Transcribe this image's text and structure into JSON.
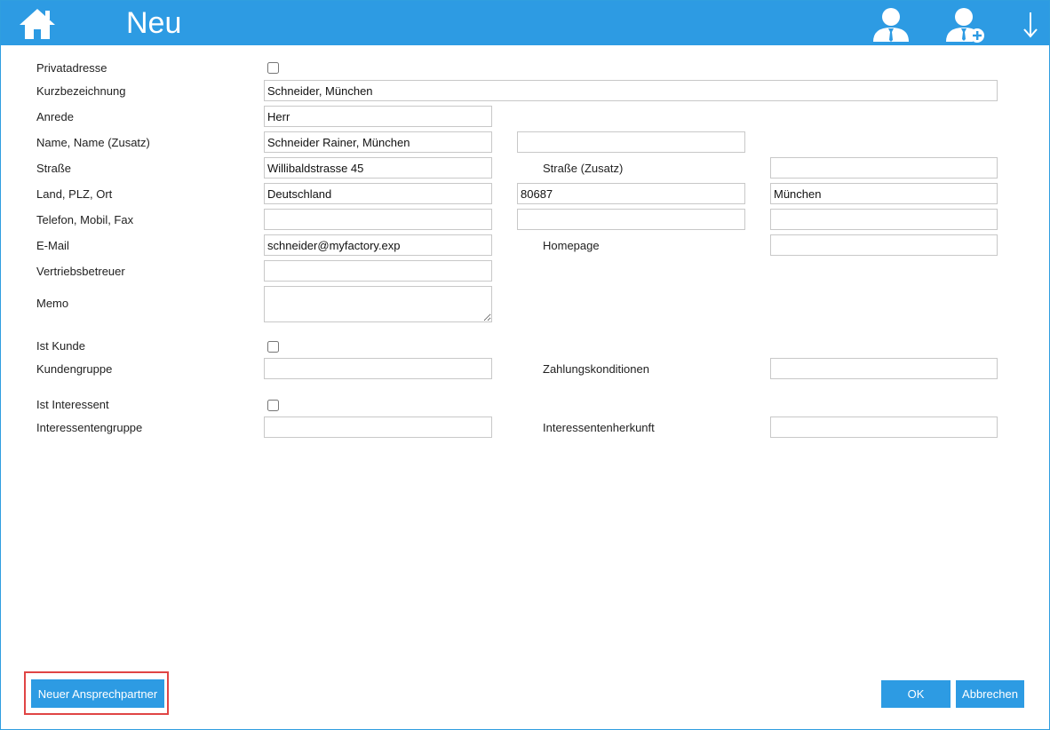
{
  "header": {
    "title": "Neu",
    "accent_color": "#2d9be3",
    "icons": [
      "home-icon",
      "contact-person-icon",
      "add-contact-person-icon",
      "arrow-down-icon"
    ]
  },
  "form": {
    "privatadresse": {
      "label": "Privatadresse",
      "checked": false
    },
    "kurzbezeichnung": {
      "label": "Kurzbezeichnung",
      "value": "Schneider, München"
    },
    "anrede": {
      "label": "Anrede",
      "value": "Herr"
    },
    "name": {
      "label": "Name, Name (Zusatz)",
      "value": "Schneider Rainer, München",
      "value2": ""
    },
    "strasse": {
      "label": "Straße",
      "value": "Willibaldstrasse 45",
      "label2": "Straße (Zusatz)",
      "value2": ""
    },
    "land": {
      "label": "Land, PLZ, Ort",
      "land": "Deutschland",
      "plz": "80687",
      "ort": "München"
    },
    "telefon": {
      "label": "Telefon, Mobil, Fax",
      "telefon": "",
      "mobil": "",
      "fax": ""
    },
    "email": {
      "label": "E-Mail",
      "value": "schneider@myfactory.exp",
      "label2": "Homepage",
      "value2": ""
    },
    "vertrieb": {
      "label": "Vertriebsbetreuer",
      "value": ""
    },
    "memo": {
      "label": "Memo",
      "value": ""
    },
    "ist_kunde": {
      "label": "Ist Kunde",
      "checked": false
    },
    "kundengruppe": {
      "label": "Kundengruppe",
      "value": "",
      "label2": "Zahlungskonditionen",
      "value2": ""
    },
    "ist_interessent": {
      "label": "Ist Interessent",
      "checked": false
    },
    "interessentengruppe": {
      "label": "Interessentengruppe",
      "value": "",
      "label2": "Interessentenherkunft",
      "value2": ""
    }
  },
  "footer": {
    "new_contact_label": "Neuer Ansprechpartner",
    "ok_label": "OK",
    "cancel_label": "Abbrechen",
    "highlight_color": "#e04545"
  }
}
